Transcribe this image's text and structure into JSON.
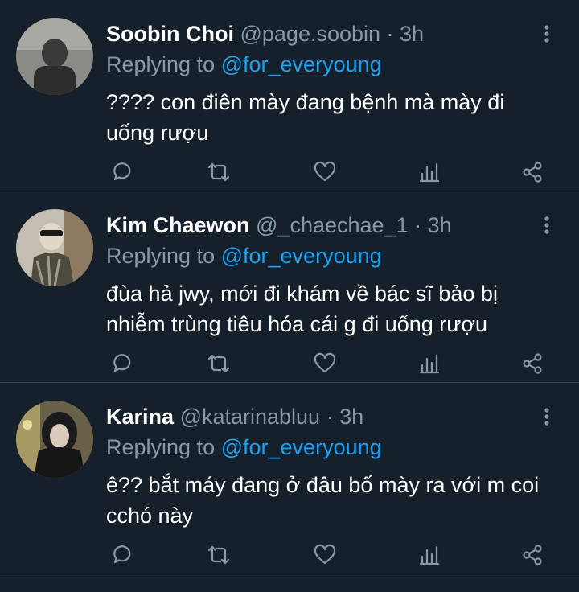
{
  "colors": {
    "background": "#15202b",
    "divider": "#38444d",
    "secondary_text": "#8899a6",
    "accent": "#1da1f2",
    "primary_text": "#ffffff"
  },
  "tweets": [
    {
      "display_name": "Soobin Choi",
      "handle": "@page.soobin",
      "time": "· 3h",
      "replying_label": "Replying to",
      "replying_to": "@for_everyoung",
      "text": "???? con điên mày đang bệnh mà mày đi uống rượu",
      "avatar_icon": "avatar-photo"
    },
    {
      "display_name": "Kim Chaewon",
      "handle": "@_chaechae_1",
      "time": "· 3h",
      "replying_label": "Replying to",
      "replying_to": "@for_everyoung",
      "text": "đùa hả jwy, mới đi khám về bác sĩ bảo bị nhiễm trùng tiêu hóa cái g đi uống rượu",
      "avatar_icon": "avatar-photo"
    },
    {
      "display_name": "Karina",
      "handle": "@katarinabluu",
      "time": "· 3h",
      "replying_label": "Replying to",
      "replying_to": "@for_everyoung",
      "text": "ê?? bắt máy đang ở đâu bố mày ra với m coi cchó này",
      "avatar_icon": "avatar-photo"
    }
  ],
  "action_icons": [
    "reply-icon",
    "retweet-icon",
    "like-icon",
    "analytics-icon",
    "share-icon"
  ]
}
